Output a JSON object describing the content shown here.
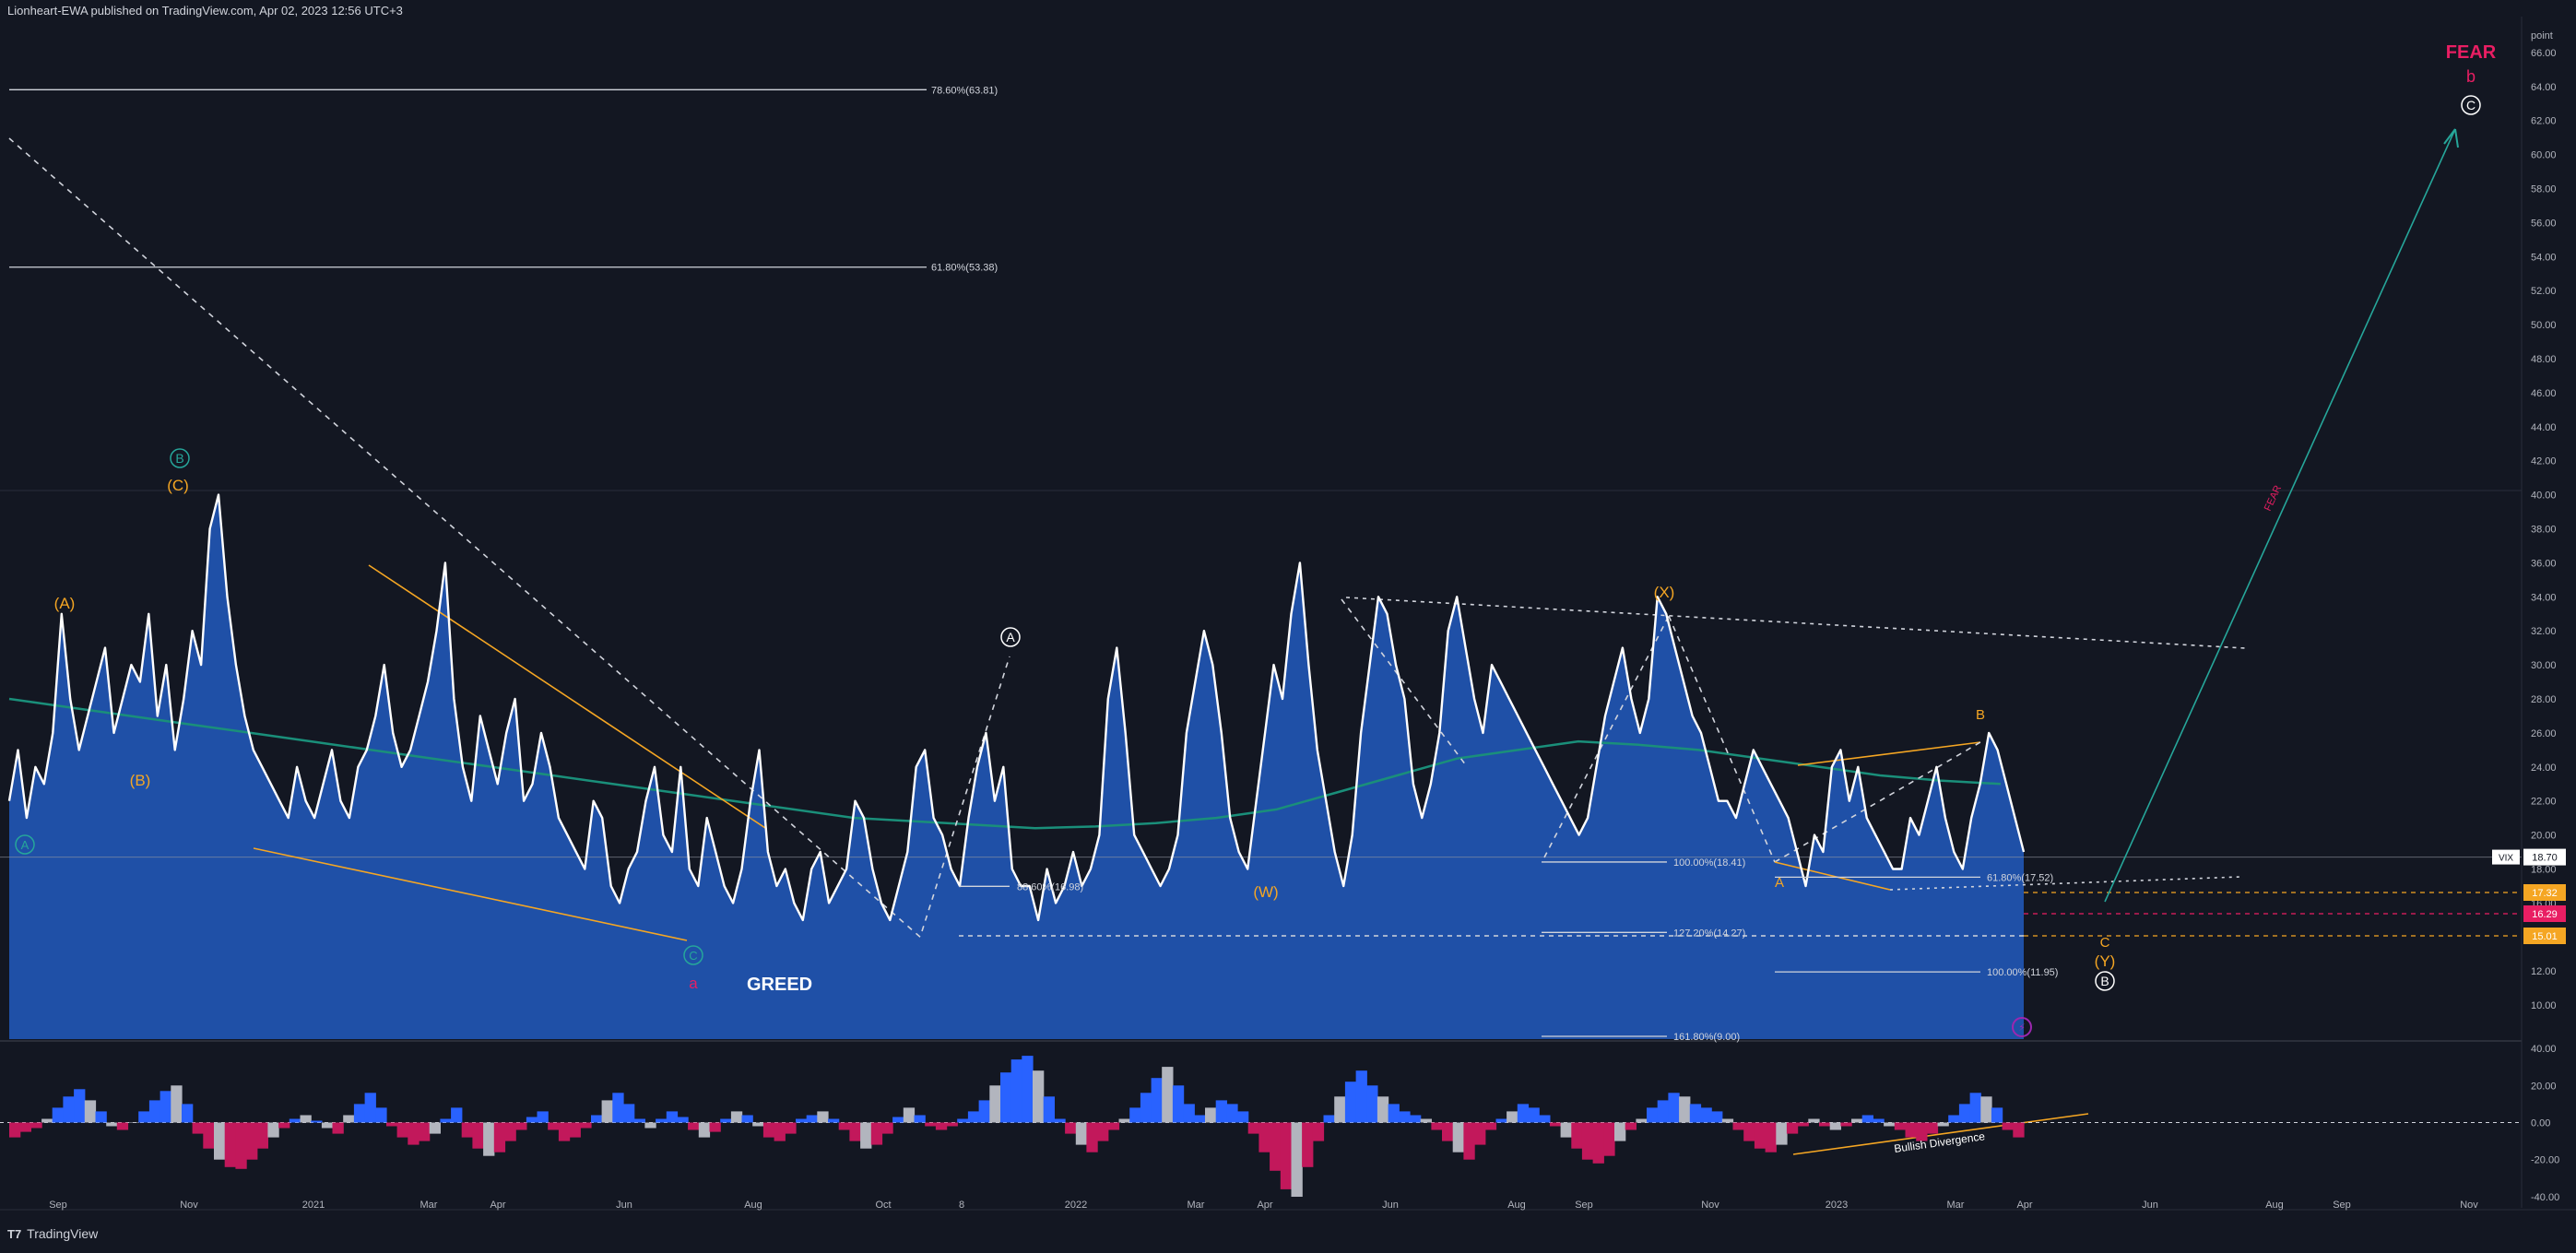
{
  "header": {
    "published": "Lionheart-EWA published on TradingView.com, Apr 02, 2023 12:56 UTC+3"
  },
  "footer": {
    "logo_mark": "T7",
    "logo_text": "TradingView"
  },
  "colors": {
    "bg": "#131722",
    "price_line": "#ffffff",
    "area_fill": "#2157b6",
    "ma_line": "#1a8f7a",
    "orange": "#f5a623",
    "pink": "#e91e63",
    "teal": "#26a69a",
    "grid": "#2a2e39",
    "hist_blue": "#2962ff",
    "hist_grey": "#b2b5be",
    "hist_red": "#c2185b"
  },
  "chart_data": [
    {
      "type": "line",
      "symbol": "VIX",
      "y_axis_unit": "point",
      "ylim": [
        8,
        68
      ],
      "x_ticks": [
        "Sep",
        "Nov",
        "2021",
        "Mar",
        "Apr",
        "Jun",
        "Aug",
        "Oct",
        "8",
        "2022",
        "Mar",
        "Apr",
        "Jun",
        "Aug",
        "Sep",
        "Nov",
        "2023",
        "Mar",
        "Apr",
        "Jun",
        "Aug",
        "Sep",
        "Nov"
      ],
      "y_ticks": [
        "66.00",
        "64.00",
        "62.00",
        "60.00",
        "58.00",
        "56.00",
        "54.00",
        "52.00",
        "50.00",
        "48.00",
        "46.00",
        "44.00",
        "42.00",
        "40.00",
        "38.00",
        "36.00",
        "34.00",
        "32.00",
        "30.00",
        "28.00",
        "26.00",
        "24.00",
        "22.00",
        "20.00",
        "18.00",
        "16.00",
        "14.00",
        "12.00",
        "10.00"
      ],
      "series": [
        {
          "values": [
            22,
            25,
            21,
            24,
            23,
            26,
            33,
            28,
            25,
            27,
            29,
            31,
            26,
            28,
            30,
            29,
            33,
            27,
            30,
            25,
            28,
            32,
            30,
            38,
            40,
            34,
            30,
            27,
            25,
            24,
            23,
            22,
            21,
            24,
            22,
            21,
            23,
            25,
            22,
            21,
            24,
            25,
            27,
            30,
            26,
            24,
            25,
            27,
            29,
            32,
            36,
            28,
            24,
            22,
            27,
            25,
            23,
            26,
            28,
            22,
            23,
            26,
            24,
            21,
            20,
            19,
            18,
            22,
            21,
            17,
            16,
            18,
            19,
            22,
            24,
            20,
            19,
            24,
            18,
            17,
            21,
            19,
            17,
            16,
            18,
            22,
            25,
            19,
            17,
            18,
            16,
            15,
            18,
            19,
            16,
            17,
            18,
            22,
            21,
            18,
            16,
            15,
            17,
            19,
            24,
            25,
            21,
            20,
            18,
            17,
            21,
            24,
            26,
            22,
            24,
            18,
            17,
            17,
            15,
            18,
            16,
            17,
            19,
            17,
            18,
            20,
            28,
            31,
            26,
            20,
            19,
            18,
            17,
            18,
            20,
            26,
            29,
            32,
            30,
            26,
            21,
            19,
            18,
            22,
            26,
            30,
            28,
            33,
            36,
            30,
            25,
            22,
            19,
            17,
            20,
            26,
            30,
            34,
            33,
            30,
            28,
            23,
            21,
            23,
            26,
            32,
            34,
            31,
            28,
            26,
            30,
            29,
            28,
            27,
            26,
            25,
            24,
            23,
            22,
            21,
            20,
            21,
            24,
            27,
            29,
            31,
            28,
            26,
            28,
            34,
            33,
            31,
            29,
            27,
            26,
            24,
            22,
            22,
            21,
            23,
            25,
            24,
            23,
            22,
            21,
            19,
            17,
            20,
            19,
            24,
            25,
            22,
            24,
            21,
            20,
            19,
            18,
            18,
            21,
            20,
            22,
            24,
            21,
            19,
            18,
            21,
            23,
            26,
            25,
            23,
            21,
            19
          ]
        }
      ],
      "moving_average": [
        28,
        27.5,
        27,
        26.5,
        26,
        25.5,
        25,
        24.5,
        24,
        23.5,
        23,
        22.5,
        22,
        21.5,
        21,
        20.8,
        20.6,
        20.4,
        20.5,
        20.7,
        21,
        21.5,
        22.5,
        23.5,
        24.5,
        25,
        25.5,
        25.3,
        25,
        24.5,
        24,
        23.5,
        23.2,
        23
      ],
      "current_price_label": "18.70",
      "symbol_label": "VIX",
      "price_tags": [
        {
          "value": 17.32,
          "label": "17.32",
          "color": "#f5a623"
        },
        {
          "value": 16.29,
          "label": "16.29",
          "color": "#e91e63"
        },
        {
          "value": 15.01,
          "label": "15.01",
          "color": "#f5a623"
        }
      ],
      "fib_levels": [
        {
          "label": "78.60%(63.81)",
          "value": 63.81
        },
        {
          "label": "61.80%(53.38)",
          "value": 53.38
        },
        {
          "label": "88.60%(16.98)",
          "value": 16.98
        },
        {
          "label": "100.00%(18.41)",
          "value": 18.41
        },
        {
          "label": "61.80%(17.52)",
          "value": 17.52
        },
        {
          "label": "127.20%(14.27)",
          "value": 14.27
        },
        {
          "label": "100.00%(11.95)",
          "value": 11.95
        },
        {
          "label": "161.80%(9.00)",
          "value": 9.0
        }
      ],
      "wave_labels": [
        {
          "text": "(A)",
          "color": "#f5a623"
        },
        {
          "text": "(B)",
          "color": "#f5a623"
        },
        {
          "text": "(C)",
          "color": "#f5a623"
        },
        {
          "text": "B",
          "color": "#26a69a",
          "circled": true
        },
        {
          "text": "A",
          "color": "#26a69a",
          "circled": true
        },
        {
          "text": "C",
          "color": "#26a69a",
          "circled": true
        },
        {
          "text": "a",
          "color": "#e91e63"
        },
        {
          "text": "A",
          "color": "#ffffff",
          "circled": true
        },
        {
          "text": "(W)",
          "color": "#f5a623"
        },
        {
          "text": "(X)",
          "color": "#f5a623"
        },
        {
          "text": "A",
          "color": "#f5a623"
        },
        {
          "text": "B",
          "color": "#f5a623"
        },
        {
          "text": "C",
          "color": "#f5a623"
        },
        {
          "text": "(Y)",
          "color": "#f5a623"
        },
        {
          "text": "B",
          "color": "#ffffff",
          "circled": true
        },
        {
          "text": "C",
          "color": "#ffffff",
          "circled": true
        },
        {
          "text": "b",
          "color": "#e91e63"
        }
      ],
      "annotations": [
        "GREED",
        "FEAR",
        "FEAR"
      ]
    },
    {
      "type": "bar",
      "title": "",
      "ylim": [
        -42,
        42
      ],
      "y_ticks": [
        "40.00",
        "20.00",
        "0.00",
        "-20.00",
        "-40.00"
      ],
      "annotation": "Bullish Divergence",
      "values": [
        -8,
        -5,
        -3,
        2,
        8,
        14,
        18,
        12,
        6,
        -2,
        -4,
        0,
        6,
        12,
        17,
        20,
        10,
        -6,
        -14,
        -20,
        -24,
        -25,
        -20,
        -14,
        -8,
        -3,
        2,
        4,
        1,
        -3,
        -6,
        4,
        10,
        16,
        8,
        -2,
        -8,
        -12,
        -10,
        -6,
        2,
        8,
        -8,
        -14,
        -18,
        -16,
        -10,
        -4,
        3,
        6,
        -4,
        -10,
        -8,
        -3,
        4,
        12,
        16,
        10,
        2,
        -3,
        2,
        6,
        3,
        -4,
        -8,
        -5,
        2,
        6,
        4,
        -2,
        -8,
        -10,
        -6,
        2,
        4,
        6,
        2,
        -4,
        -10,
        -14,
        -12,
        -6,
        3,
        8,
        4,
        -2,
        -4,
        -2,
        2,
        6,
        12,
        20,
        27,
        34,
        36,
        28,
        14,
        2,
        -6,
        -12,
        -16,
        -10,
        -4,
        2,
        8,
        16,
        24,
        30,
        20,
        10,
        4,
        8,
        12,
        10,
        6,
        -6,
        -16,
        -26,
        -36,
        -40,
        -24,
        -10,
        4,
        14,
        22,
        28,
        20,
        14,
        10,
        6,
        4,
        2,
        -4,
        -10,
        -16,
        -20,
        -12,
        -4,
        2,
        6,
        10,
        8,
        4,
        -2,
        -8,
        -14,
        -20,
        -22,
        -18,
        -10,
        -4,
        2,
        8,
        12,
        16,
        14,
        10,
        8,
        6,
        2,
        -4,
        -10,
        -14,
        -16,
        -12,
        -6,
        -2,
        2,
        -2,
        -4,
        -2,
        2,
        4,
        2,
        -2,
        -4,
        -8,
        -10,
        -6,
        -2,
        4,
        10,
        16,
        14,
        8,
        -4,
        -8
      ]
    }
  ]
}
